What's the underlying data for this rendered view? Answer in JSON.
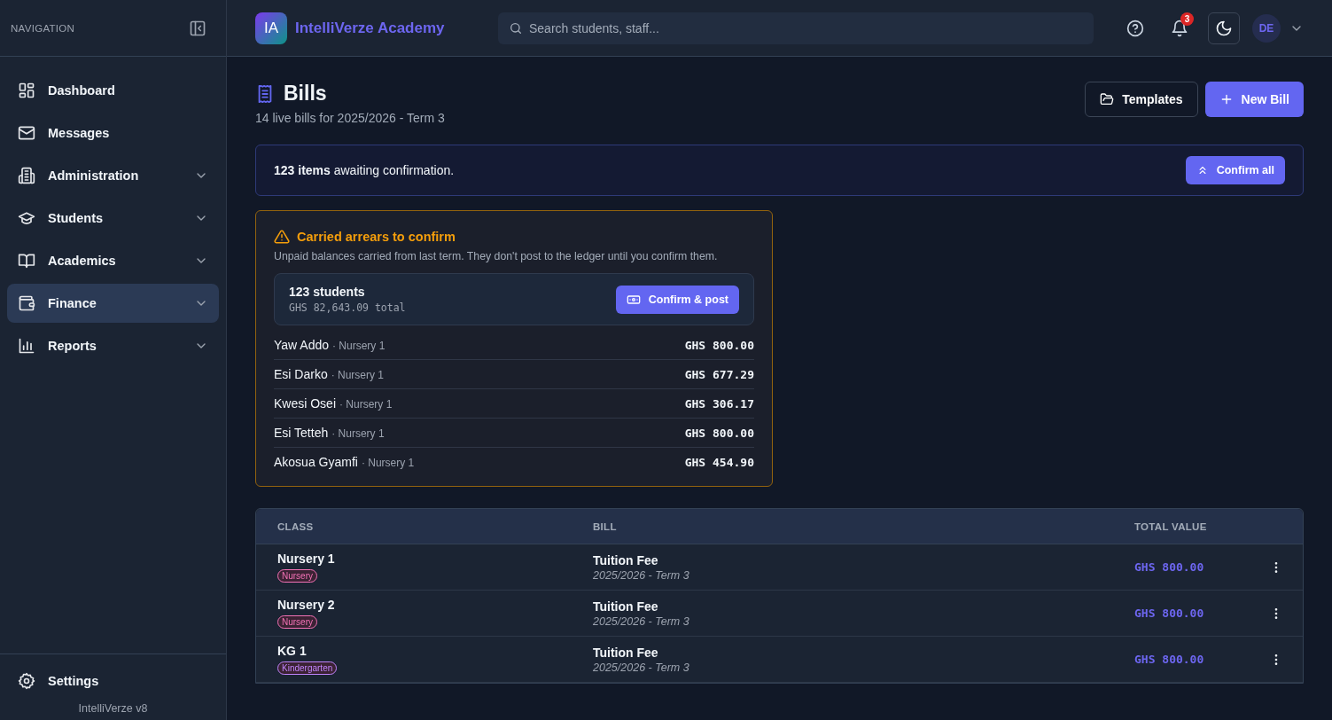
{
  "sidebar": {
    "heading": "NAVIGATION",
    "items": [
      {
        "label": "Dashboard",
        "expandable": false,
        "selected": false
      },
      {
        "label": "Messages",
        "expandable": false,
        "selected": false
      },
      {
        "label": "Administration",
        "expandable": true,
        "selected": false
      },
      {
        "label": "Students",
        "expandable": true,
        "selected": false
      },
      {
        "label": "Academics",
        "expandable": true,
        "selected": false
      },
      {
        "label": "Finance",
        "expandable": true,
        "selected": true
      },
      {
        "label": "Reports",
        "expandable": true,
        "selected": false
      }
    ],
    "footer_item": {
      "label": "Settings"
    },
    "version": "IntelliVerze v8"
  },
  "header": {
    "logo_initials": "IA",
    "brand": "IntelliVerze Academy",
    "search": {
      "placeholder": "Search students, staff..."
    },
    "notification_count": "3",
    "avatar_initials": "DE"
  },
  "page": {
    "title": "Bills",
    "subtitle": "14 live bills for 2025/2026 - Term 3",
    "buttons": [
      {
        "label": "Templates",
        "kind": "secondary"
      },
      {
        "label": "New Bill",
        "kind": "primary"
      }
    ]
  },
  "notice": {
    "text": "**123 items** awaiting confirmation.",
    "button": "Confirm all"
  },
  "arrears": {
    "title": "Carried arrears to confirm",
    "description": "Unpaid balances carried from last term. They don't post to the ledger until you confirm them.",
    "summary": {
      "count": "123 students",
      "total": "GHS 82,643.09 total",
      "button": "Confirm & post"
    },
    "rows": [
      {
        "name": "Yaw Addo",
        "class": "· Nursery 1",
        "amount": "GHS 800.00"
      },
      {
        "name": "Esi Darko",
        "class": "· Nursery 1",
        "amount": "GHS 677.29"
      },
      {
        "name": "Kwesi Osei",
        "class": "· Nursery 1",
        "amount": "GHS 306.17"
      },
      {
        "name": "Esi Tetteh",
        "class": "· Nursery 1",
        "amount": "GHS 800.00"
      },
      {
        "name": "Akosua Gyamfi",
        "class": "· Nursery 1",
        "amount": "GHS 454.90"
      }
    ]
  },
  "table": {
    "columns": [
      "CLASS",
      "BILL",
      "TOTAL VALUE"
    ],
    "rows": [
      {
        "class": "Nursery 1",
        "tag": {
          "label": "Nursery",
          "color": "#f472b6"
        },
        "bill": "Tuition Fee",
        "term": "2025/2026 - Term 3",
        "total": "GHS 800.00"
      },
      {
        "class": "Nursery 2",
        "tag": {
          "label": "Nursery",
          "color": "#f472b6"
        },
        "bill": "Tuition Fee",
        "term": "2025/2026 - Term 3",
        "total": "GHS 800.00"
      },
      {
        "class": "KG 1",
        "tag": {
          "label": "Kindergarten",
          "color": "#c084fc"
        },
        "bill": "Tuition Fee",
        "term": "2025/2026 - Term 3",
        "total": "GHS 800.00"
      }
    ]
  }
}
